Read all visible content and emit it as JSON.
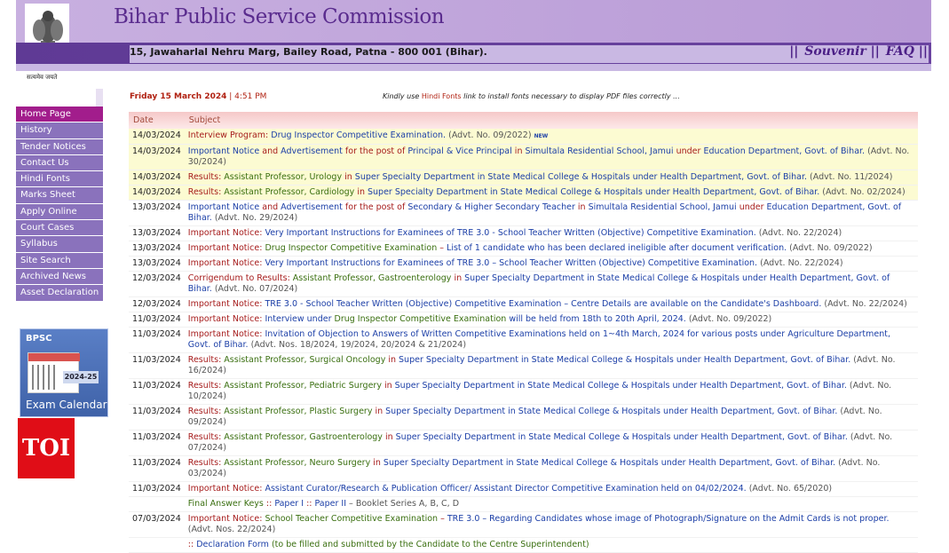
{
  "header": {
    "title": "Bihar Public Service Commission",
    "address": "15, Jawaharlal Nehru Marg, Bailey Road, Patna - 800 001 (Bihar).",
    "links": [
      "Souvenir",
      "FAQ"
    ],
    "emblem_caption": "सत्यमेव जयते"
  },
  "sidebar": {
    "items": [
      {
        "label": "Home Page",
        "active": true
      },
      {
        "label": "History"
      },
      {
        "label": "Tender Notices"
      },
      {
        "label": "Contact Us"
      },
      {
        "label": "Hindi Fonts"
      },
      {
        "label": "Marks Sheet"
      },
      {
        "label": "Apply Online"
      },
      {
        "label": "Court Cases"
      },
      {
        "label": "Syllabus"
      },
      {
        "label": "Site Search"
      },
      {
        "label": "Archived News"
      },
      {
        "label": "Asset Declaration"
      }
    ],
    "calendar": {
      "brand": "BPSC",
      "year": "2024-25",
      "label": "Exam Calendar"
    },
    "toi": "TOI"
  },
  "topline": {
    "date": "Friday 15 March 2024",
    "time": "4:51 PM",
    "note_pre": "Kindly use ",
    "note_link": "Hindi Fonts",
    "note_post": " link to install fonts necessary to display PDF files correctly ..."
  },
  "table": {
    "headers": [
      "Date",
      "Subject"
    ]
  },
  "colors": {
    "accent": "#5f3a95",
    "menu": "#8a72bc",
    "active": "#a21d8c"
  }
}
